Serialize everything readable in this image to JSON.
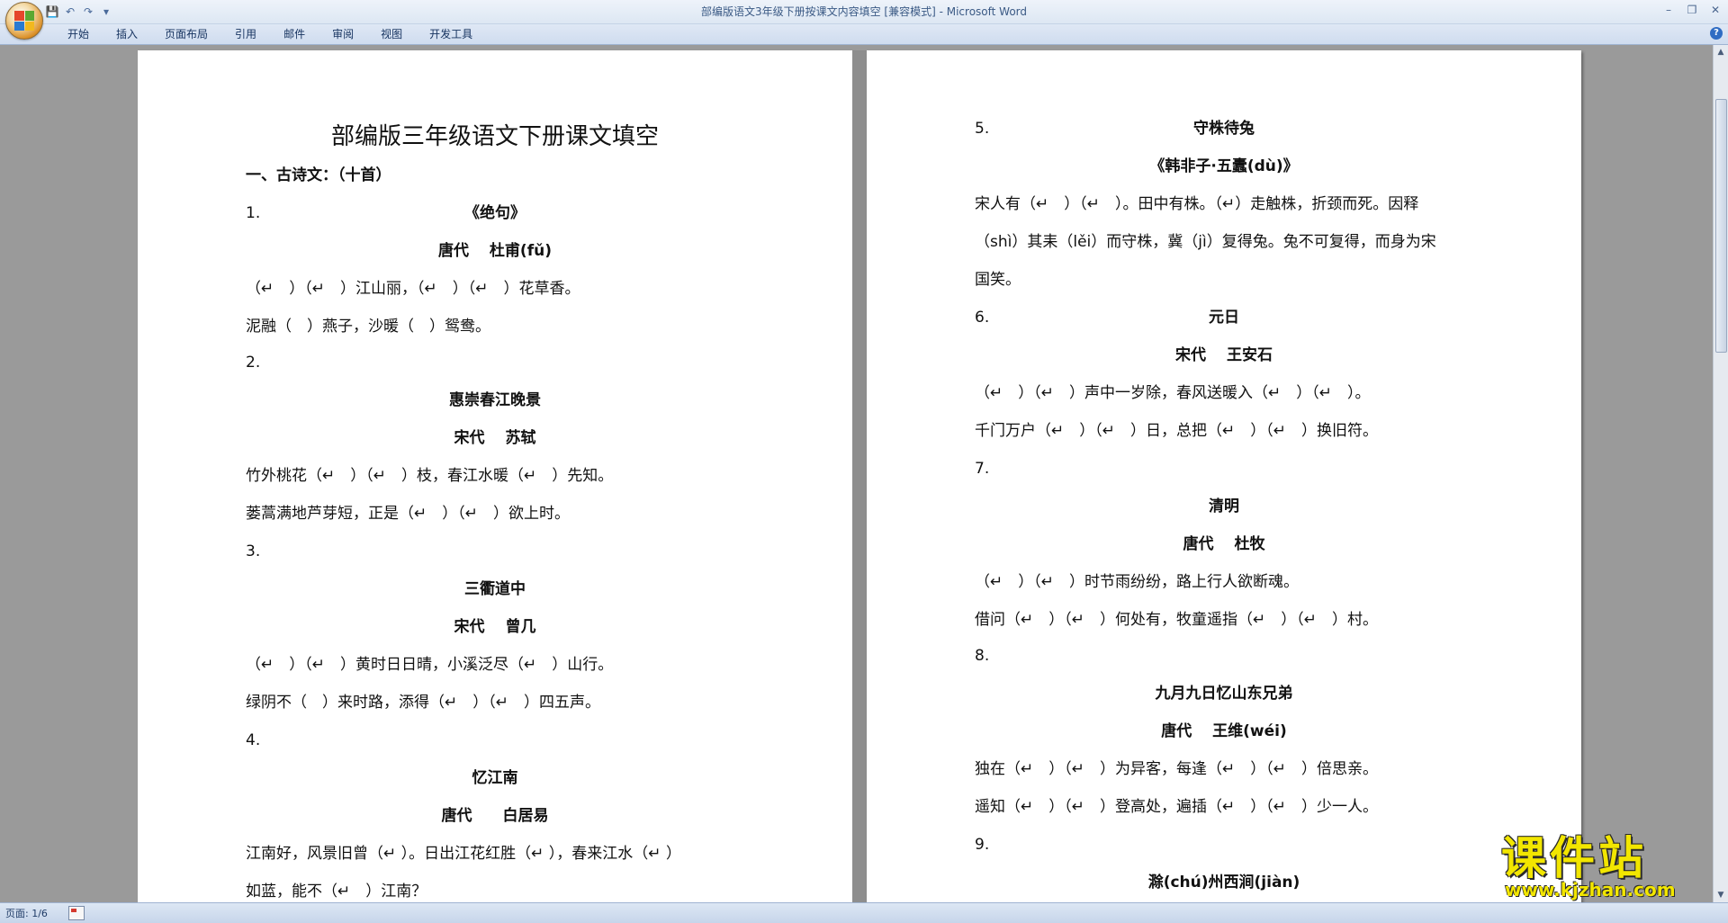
{
  "window": {
    "title": "部编版语文3年级下册按课文内容填空 [兼容模式] - Microsoft Word",
    "controls": [
      "–",
      "❐",
      "✕"
    ]
  },
  "quick_access": [
    "💾",
    "↶",
    "↷",
    "▾"
  ],
  "ribbon": {
    "tabs": [
      "开始",
      "插入",
      "页面布局",
      "引用",
      "邮件",
      "审阅",
      "视图",
      "开发工具"
    ]
  },
  "status": {
    "page": "页面: 1/6"
  },
  "watermark": {
    "name": "课件站",
    "url": "www.kjzhan.com"
  },
  "para_mark": "↵",
  "left_page": {
    "title": "部编版三年级语文下册课文填空",
    "section": "一、古诗文：（十首）",
    "poems": [
      {
        "num": "1.",
        "name": "《绝句》",
        "author": "唐代 　杜甫(fǔ)",
        "lines": [
          "（↵　）（↵　）江山丽，（↵　）（↵　）花草香。",
          "泥融（　）燕子，沙暖（　）鸳鸯。"
        ]
      },
      {
        "num": "2.",
        "name": "惠崇春江晚景",
        "author": "宋代　 苏轼",
        "lines": [
          "竹外桃花（↵　）（↵　）枝，春江水暖（↵　）先知。",
          "蒌蒿满地芦芽短，正是（↵　）（↵　）欲上时。"
        ]
      },
      {
        "num": "3.",
        "name": "三衢道中",
        "author": "宋代　 曾几",
        "lines": [
          "（↵　）（↵　）黄时日日晴，小溪泛尽（↵　）山行。",
          "绿阴不（　）来时路，添得（↵　）（↵　）四五声。"
        ]
      },
      {
        "num": "4.",
        "name": "忆江南",
        "author": "唐代　　白居易",
        "lines": [
          "江南好，风景旧曾（↵ ）。日出江花红胜（↵ ），春来江水（↵ ）",
          "如蓝，能不（↵　）江南？"
        ]
      }
    ]
  },
  "right_page": {
    "poems": [
      {
        "num": "5.",
        "name": "守株待兔",
        "author": "《韩非子·五蠹(dù)》",
        "lines": [
          "宋人有（↵　）（↵　）。田中有株。（↵）走触株，折颈而死。因释",
          "（shì）其耒（lěi）而守株，冀（jì）复得兔。兔不可复得，而身为宋",
          "国笑。"
        ]
      },
      {
        "num": "6.",
        "name": "元日",
        "author": "宋代　 王安石",
        "lines": [
          "（↵　）（↵　）声中一岁除，春风送暖入（↵　）（↵　）。",
          "千门万户（↵　）（↵　）日，总把（↵　）（↵　）换旧符。"
        ]
      },
      {
        "num": "7.",
        "name": "清明",
        "author": "唐代　 杜牧",
        "lines": [
          "（↵　）（↵　）时节雨纷纷，路上行人欲断魂。",
          "借问（↵　）（↵　）何处有，牧童遥指（↵　）（↵　）村。"
        ]
      },
      {
        "num": "8.",
        "name": "九月九日忆山东兄弟",
        "author": "唐代　 王维(wéi)",
        "lines": [
          "独在（↵　）（↵　）为异客，每逢（↵　）（↵　）倍思亲。",
          "遥知（↵　）（↵　）登高处，遍插（↵　）（↵　）少一人。"
        ]
      },
      {
        "num": "9.",
        "name": "滁(chú)州西涧(jiàn)",
        "author": "",
        "lines": []
      }
    ]
  }
}
